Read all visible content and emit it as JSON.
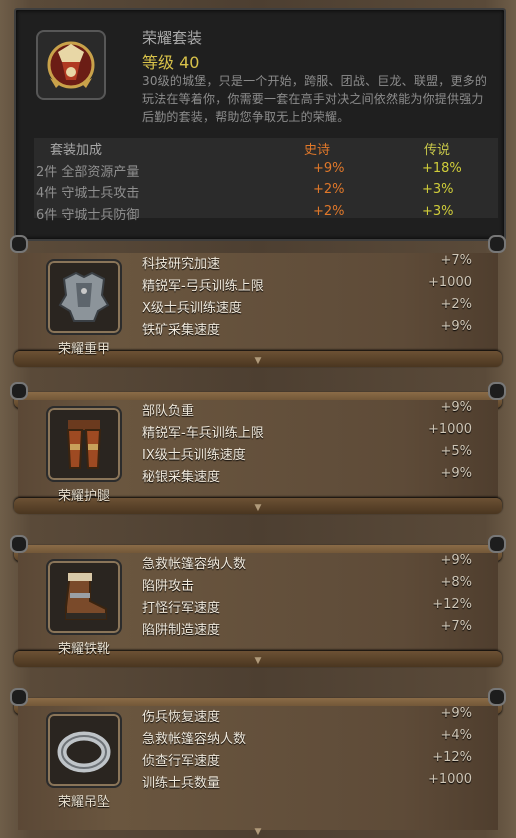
{
  "set": {
    "title": "荣耀套装",
    "level": "等级 40",
    "description": "30级的城堡，只是一个开始，跨服、团战、巨龙、联盟，更多的玩法在等着你，你需要一套在高手对决之间依然能为你提供强力后勤的套装，帮助您争取无上的荣耀。",
    "icon": "glory-shield-icon",
    "bonus_header": {
      "label": "套装加成",
      "epic": "史诗",
      "legendary": "传说"
    },
    "bonuses": [
      {
        "label": "2件 全部资源产量",
        "epic": "+9%",
        "legendary": "+18%"
      },
      {
        "label": "4件 守城士兵攻击",
        "epic": "+2%",
        "legendary": "+3%"
      },
      {
        "label": "6件 守城士兵防御",
        "epic": "+2%",
        "legendary": "+3%"
      }
    ]
  },
  "items": [
    {
      "name": "荣耀重甲",
      "icon": "armor-icon",
      "stats": [
        {
          "name": "科技研究加速",
          "value": "+7%"
        },
        {
          "name": "精锐军-弓兵训练上限",
          "value": "+1000"
        },
        {
          "name": "X级士兵训练速度",
          "value": "+2%"
        },
        {
          "name": "铁矿采集速度",
          "value": "+9%"
        }
      ]
    },
    {
      "name": "荣耀护腿",
      "icon": "leg-armor-icon",
      "stats": [
        {
          "name": "部队负重",
          "value": "+9%"
        },
        {
          "name": "精锐军-车兵训练上限",
          "value": "+1000"
        },
        {
          "name": "IX级士兵训练速度",
          "value": "+5%"
        },
        {
          "name": "秘银采集速度",
          "value": "+9%"
        }
      ]
    },
    {
      "name": "荣耀铁靴",
      "icon": "boot-icon",
      "stats": [
        {
          "name": "急救帐篷容纳人数",
          "value": "+9%"
        },
        {
          "name": "陷阱攻击",
          "value": "+8%"
        },
        {
          "name": "打怪行军速度",
          "value": "+12%"
        },
        {
          "name": "陷阱制造速度",
          "value": "+7%"
        }
      ]
    },
    {
      "name": "荣耀吊坠",
      "icon": "ring-icon",
      "stats": [
        {
          "name": "伤兵恢复速度",
          "value": "+9%"
        },
        {
          "name": "急救帐篷容纳人数",
          "value": "+4%"
        },
        {
          "name": "侦查行军速度",
          "value": "+12%"
        },
        {
          "name": "训练士兵数量",
          "value": "+1000"
        }
      ]
    }
  ],
  "colors": {
    "epic": "#e0782a",
    "legendary": "#d0cd3a",
    "level": "#d8c24a"
  }
}
